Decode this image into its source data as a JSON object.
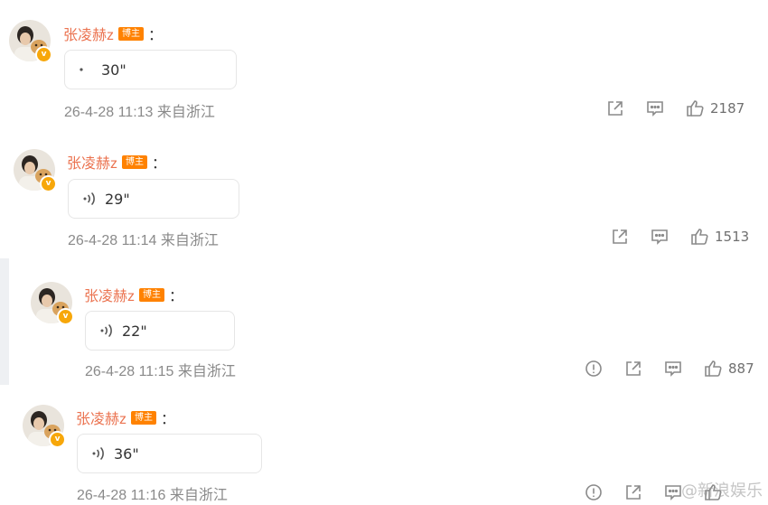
{
  "comments": [
    {
      "username": "张凌赫z",
      "role_badge": "博主",
      "colon": "：",
      "voice_duration": "30\"",
      "timestamp": "26-4-28 11:13",
      "source": "来自浙江",
      "likes": "2187",
      "has_report": false
    },
    {
      "username": "张凌赫z",
      "role_badge": "博主",
      "colon": "：",
      "voice_duration": "29\"",
      "timestamp": "26-4-28 11:14",
      "source": "来自浙江",
      "likes": "1513",
      "has_report": false
    },
    {
      "username": "张凌赫z",
      "role_badge": "博主",
      "colon": "：",
      "voice_duration": "22\"",
      "timestamp": "26-4-28 11:15",
      "source": "来自浙江",
      "likes": "887",
      "has_report": true
    },
    {
      "username": "张凌赫z",
      "role_badge": "博主",
      "colon": "：",
      "voice_duration": "36\"",
      "timestamp": "26-4-28 11:16",
      "source": "来自浙江",
      "likes": "",
      "has_report": true
    }
  ],
  "watermark": "@新浪娱乐",
  "icons": {
    "verified": "verified-badge-icon",
    "voice": "voice-wave-icon",
    "report": "report-icon",
    "share": "share-icon",
    "comment": "comment-icon",
    "like": "thumbs-up-icon"
  },
  "colors": {
    "username": "#eb7350",
    "role_badge": "#ff8200",
    "verified": "#f7a70a",
    "meta_text": "#8a8a8a",
    "icon": "#8a8a8a"
  }
}
